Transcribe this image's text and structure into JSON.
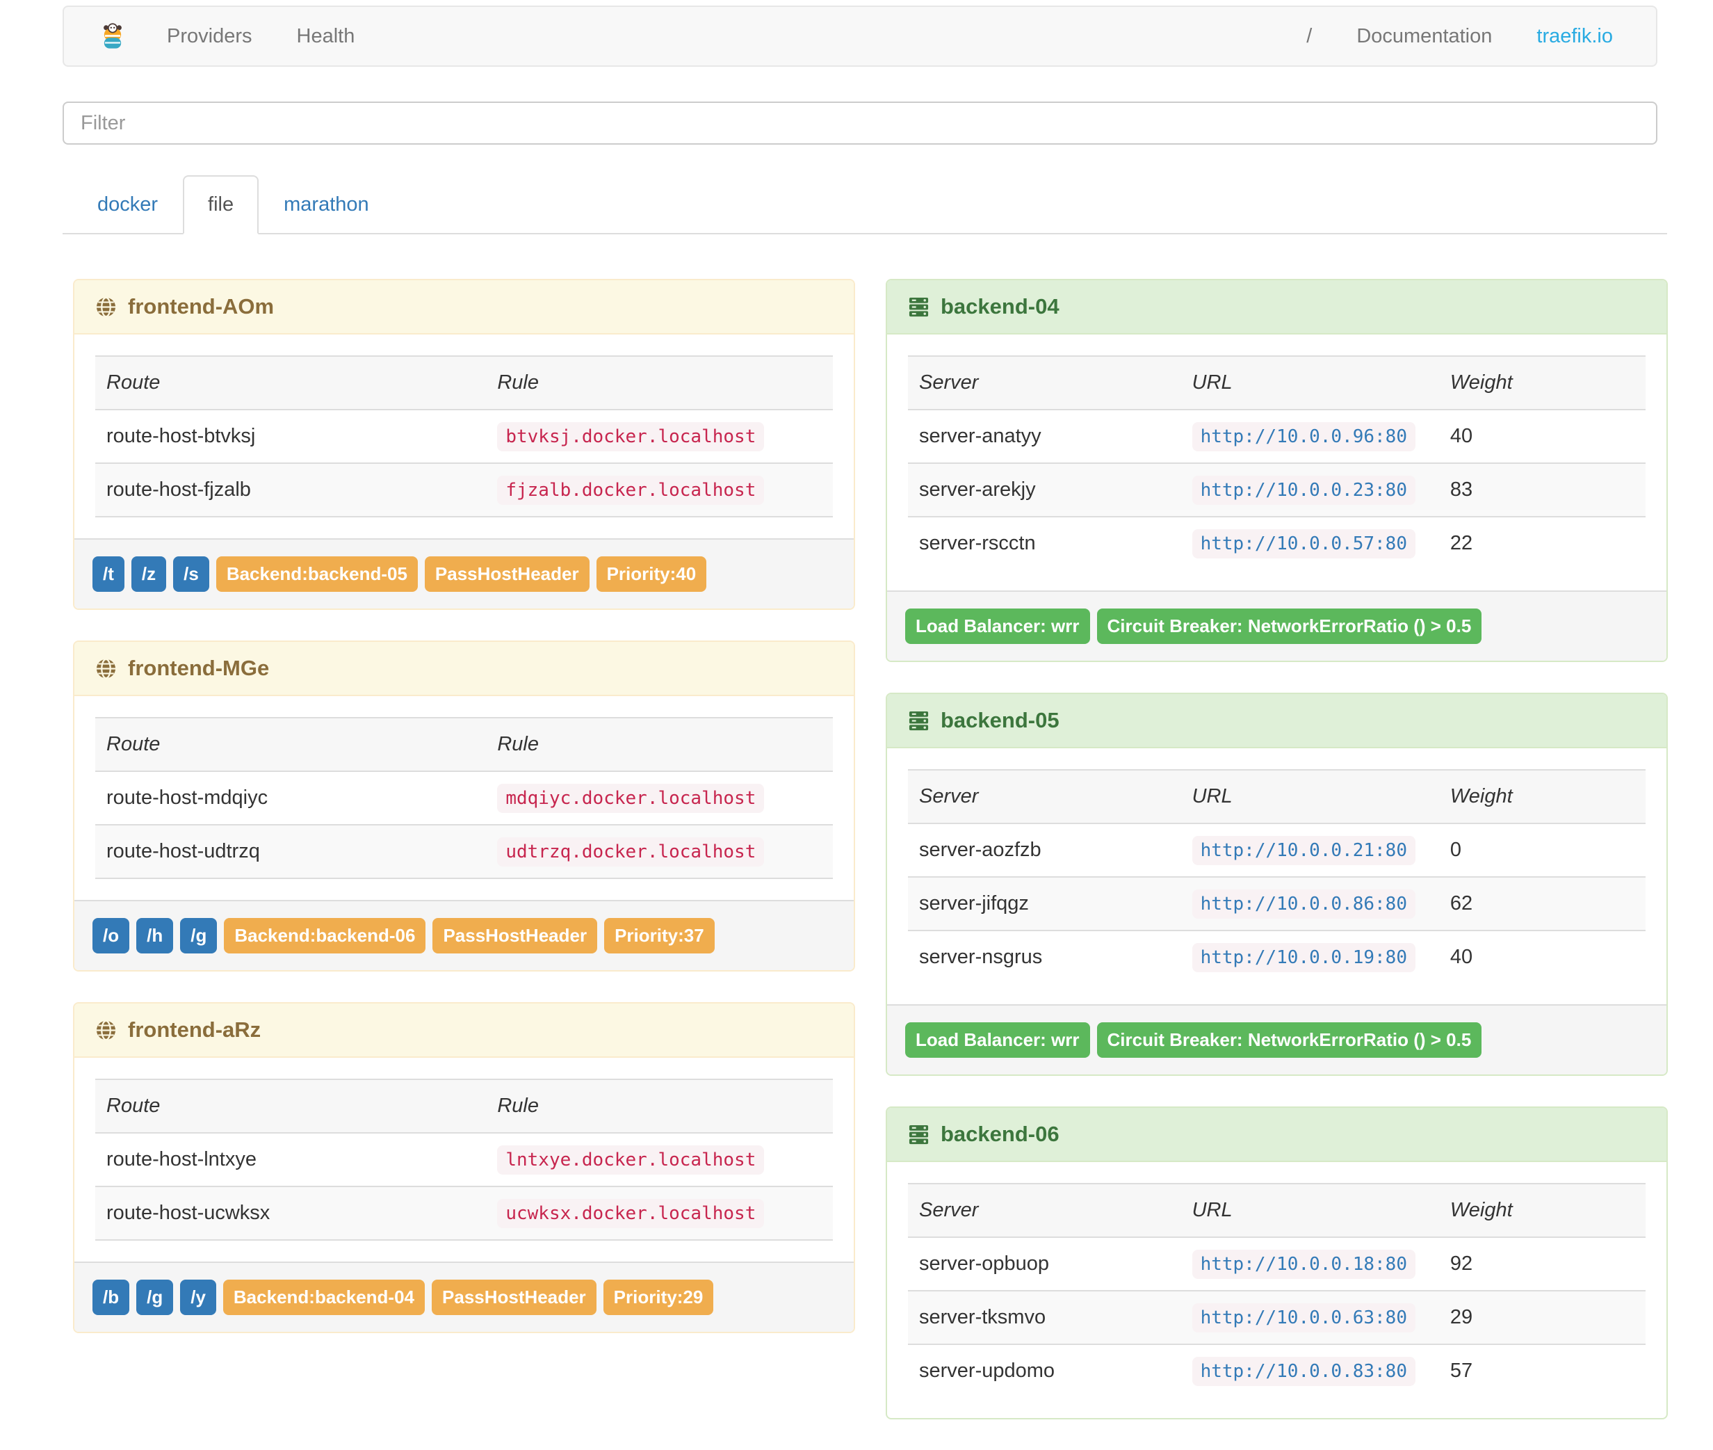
{
  "navbar": {
    "brand_icon": "traefik-logo",
    "links": [
      {
        "label": "Providers"
      },
      {
        "label": "Health"
      }
    ],
    "right_links": [
      {
        "label": "/",
        "kind": "plain"
      },
      {
        "label": "Documentation",
        "kind": "plain"
      },
      {
        "label": "traefik.io",
        "kind": "brand"
      }
    ]
  },
  "filter": {
    "placeholder": "Filter",
    "value": ""
  },
  "tabs": [
    {
      "label": "docker",
      "active": false
    },
    {
      "label": "file",
      "active": true
    },
    {
      "label": "marathon",
      "active": false
    }
  ],
  "frontends": {
    "columns": [
      "Route",
      "Rule"
    ],
    "icon": "globe-icon",
    "items": [
      {
        "title": "frontend-AOm",
        "routes": [
          {
            "route": "route-host-btvksj",
            "rule": "btvksj.docker.localhost"
          },
          {
            "route": "route-host-fjzalb",
            "rule": "fjzalb.docker.localhost"
          }
        ],
        "path_badges": [
          "/t",
          "/z",
          "/s"
        ],
        "config_badges": [
          "Backend:backend-05",
          "PassHostHeader",
          "Priority:40"
        ]
      },
      {
        "title": "frontend-MGe",
        "routes": [
          {
            "route": "route-host-mdqiyc",
            "rule": "mdqiyc.docker.localhost"
          },
          {
            "route": "route-host-udtrzq",
            "rule": "udtrzq.docker.localhost"
          }
        ],
        "path_badges": [
          "/o",
          "/h",
          "/g"
        ],
        "config_badges": [
          "Backend:backend-06",
          "PassHostHeader",
          "Priority:37"
        ]
      },
      {
        "title": "frontend-aRz",
        "routes": [
          {
            "route": "route-host-lntxye",
            "rule": "lntxye.docker.localhost"
          },
          {
            "route": "route-host-ucwksx",
            "rule": "ucwksx.docker.localhost"
          }
        ],
        "path_badges": [
          "/b",
          "/g",
          "/y"
        ],
        "config_badges": [
          "Backend:backend-04",
          "PassHostHeader",
          "Priority:29"
        ]
      }
    ]
  },
  "backends": {
    "columns": [
      "Server",
      "URL",
      "Weight"
    ],
    "icon": "server-icon",
    "items": [
      {
        "title": "backend-04",
        "servers": [
          {
            "server": "server-anatyy",
            "url": "http://10.0.0.96:80",
            "weight": "40"
          },
          {
            "server": "server-arekjy",
            "url": "http://10.0.0.23:80",
            "weight": "83"
          },
          {
            "server": "server-rscctn",
            "url": "http://10.0.0.57:80",
            "weight": "22"
          }
        ],
        "config_badges": [
          "Load Balancer: wrr",
          "Circuit Breaker: NetworkErrorRatio () > 0.5"
        ]
      },
      {
        "title": "backend-05",
        "servers": [
          {
            "server": "server-aozfzb",
            "url": "http://10.0.0.21:80",
            "weight": "0"
          },
          {
            "server": "server-jifqgz",
            "url": "http://10.0.0.86:80",
            "weight": "62"
          },
          {
            "server": "server-nsgrus",
            "url": "http://10.0.0.19:80",
            "weight": "40"
          }
        ],
        "config_badges": [
          "Load Balancer: wrr",
          "Circuit Breaker: NetworkErrorRatio () > 0.5"
        ]
      },
      {
        "title": "backend-06",
        "servers": [
          {
            "server": "server-opbuop",
            "url": "http://10.0.0.18:80",
            "weight": "92"
          },
          {
            "server": "server-tksmvo",
            "url": "http://10.0.0.63:80",
            "weight": "29"
          },
          {
            "server": "server-updomo",
            "url": "http://10.0.0.83:80",
            "weight": "57"
          }
        ],
        "config_badges": []
      }
    ]
  },
  "colors": {
    "brand_link": "#29abe2",
    "nav_link": "#777777",
    "tab_link": "#337ab7",
    "frontend_accent": "#8a6d3b",
    "backend_accent": "#3c763d",
    "badge_primary": "#337ab7",
    "badge_warning": "#f0ad4e",
    "badge_success": "#5cb85c",
    "code_rule": "#c7254e",
    "code_url": "#337ab7"
  }
}
